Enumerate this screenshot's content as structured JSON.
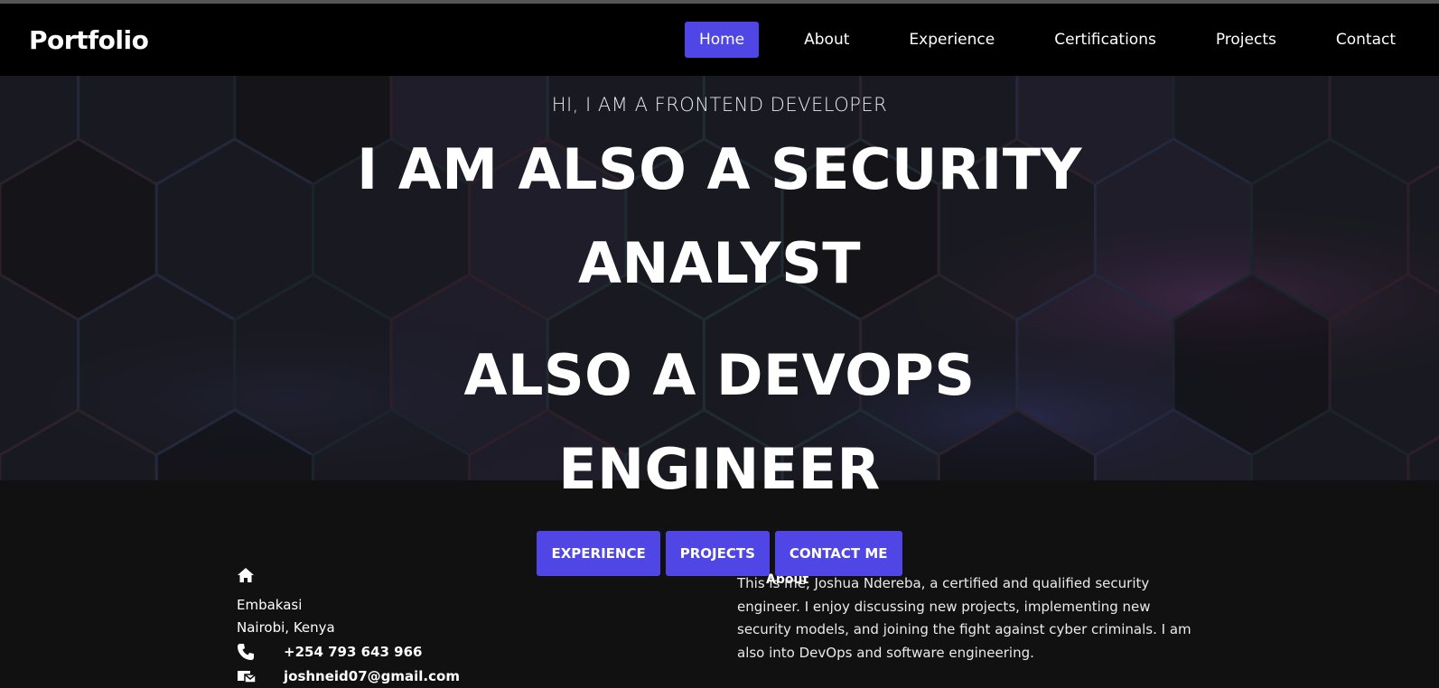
{
  "nav": {
    "brand": "Portfolio",
    "items": [
      {
        "label": "Home",
        "active": true
      },
      {
        "label": "About",
        "active": false
      },
      {
        "label": "Experience",
        "active": false
      },
      {
        "label": "Certifications",
        "active": false
      },
      {
        "label": "Projects",
        "active": false
      },
      {
        "label": "Contact",
        "active": false
      }
    ]
  },
  "hero": {
    "subtitle": "HI, I AM A FRONTEND DEVELOPER",
    "title_line1": "I AM ALSO A SECURITY",
    "title_line2": "ANALYST",
    "title2_line1": "ALSO A DEVOPS",
    "title2_line2": "ENGINEER",
    "buttons": [
      {
        "label": "EXPERIENCE"
      },
      {
        "label": "PROJECTS"
      },
      {
        "label": "CONTACT ME"
      }
    ]
  },
  "contact": {
    "address_line1": "Embakasi",
    "address_line2": "Nairobi, Kenya",
    "phone": "+254 793 643 966",
    "email": "joshneid07@gmail.com"
  },
  "about": {
    "heading": "About",
    "text": "This is me, Joshua Ndereba, a certified and qualified security engineer. I enjoy discussing new projects, implementing new security models, and joining the fight against cyber criminals. I am also into DevOps and software engineering."
  },
  "colors": {
    "accent": "#4f46e5",
    "nav_bg": "#000000",
    "page_bg": "#111111"
  },
  "icons": {
    "home": "home-icon",
    "phone": "phone-icon",
    "email": "email-icon"
  }
}
